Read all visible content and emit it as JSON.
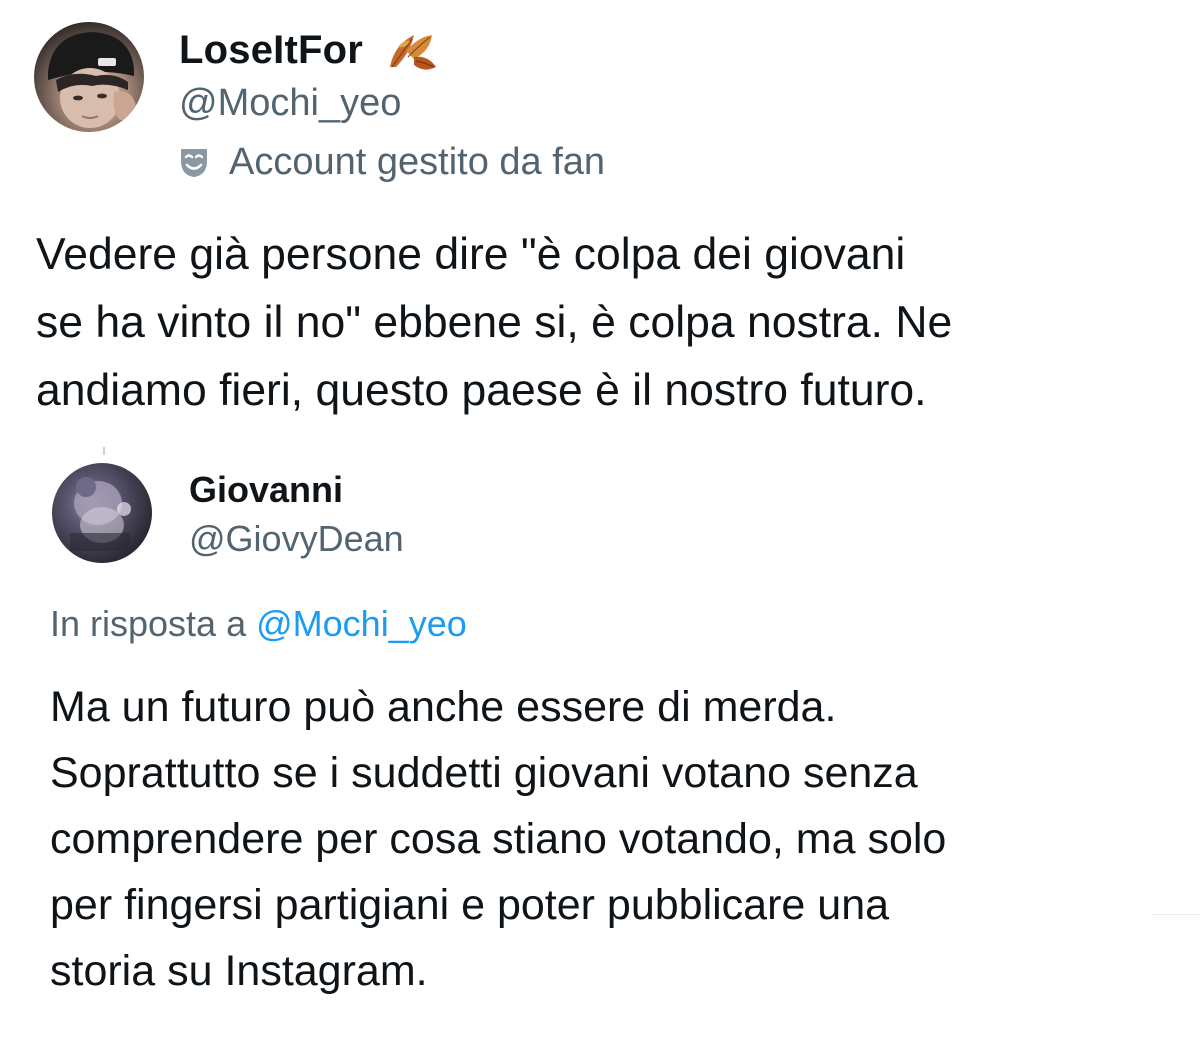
{
  "main_tweet": {
    "display_name": "LoseItFor",
    "handle": "@Mochi_yeo",
    "label": "Account gestito da fan",
    "text": "Vedere già persone dire \"è colpa dei giovani\nse ha vinto il no\" ebbene si, è colpa nostra. Ne\nandiamo fieri, questo paese è il nostro futuro.",
    "badge_icon": "autumn-leaves-icon",
    "label_icon": "theater-mask-icon"
  },
  "reply_tweet": {
    "display_name": "Giovanni",
    "handle": "@GiovyDean",
    "reply_prefix": "In risposta a",
    "reply_mention": "@Mochi_yeo",
    "text": "Ma un futuro può anche essere di merda.\nSoprattutto se i suddetti giovani votano senza\ncomprendere per cosa stiano votando, ma solo\nper fingersi partigiani e poter pubblicare una\nstoria su Instagram."
  },
  "colors": {
    "text_primary": "#0f1419",
    "text_secondary": "#536471",
    "link": "#1d9bf0",
    "background": "#ffffff"
  }
}
